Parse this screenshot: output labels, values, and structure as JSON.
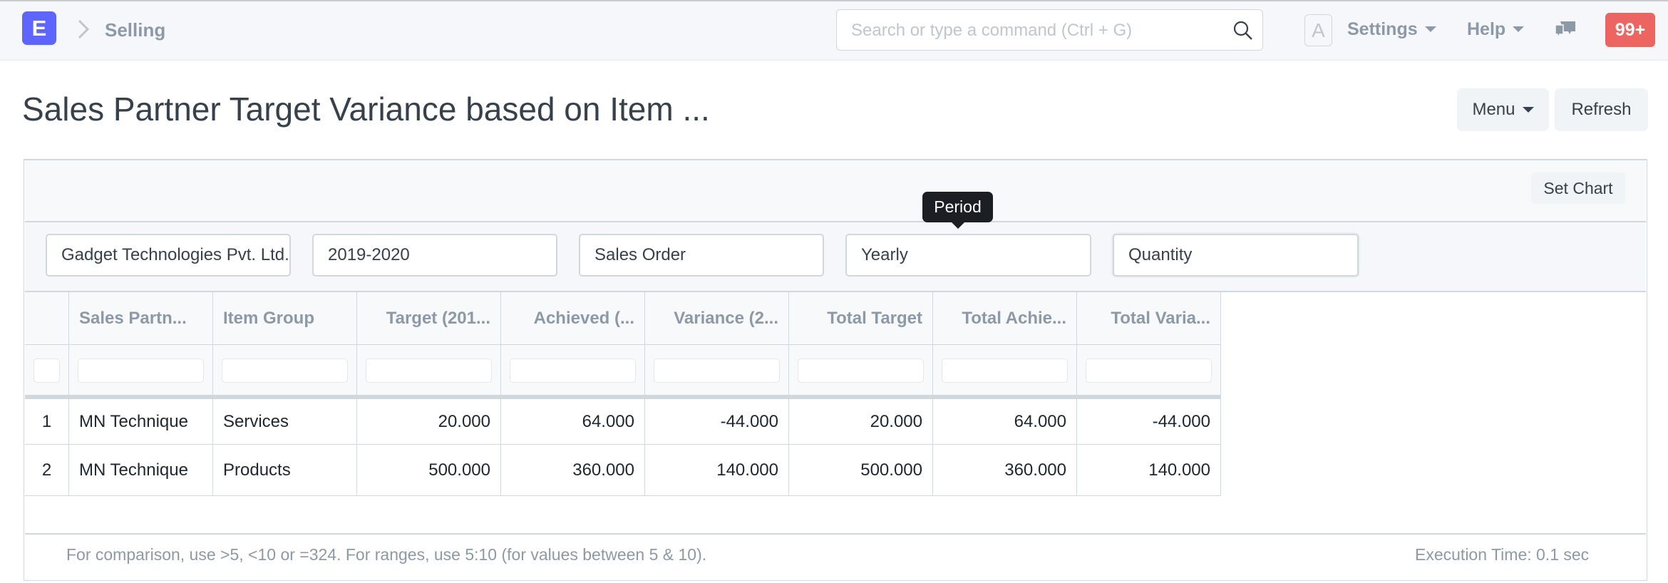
{
  "navbar": {
    "logo_letter": "E",
    "breadcrumb": "Selling",
    "search_placeholder": "Search or type a command (Ctrl + G)",
    "avatar_letter": "A",
    "settings_label": "Settings",
    "help_label": "Help",
    "notifications_badge": "99+",
    "colors": {
      "brand": "#5e64ff",
      "badge": "#ed6561"
    }
  },
  "page": {
    "title": "Sales Partner Target Variance based on Item ...",
    "menu_label": "Menu",
    "refresh_label": "Refresh"
  },
  "report": {
    "set_chart_label": "Set Chart",
    "tooltip": "Period",
    "filters": [
      {
        "name": "company",
        "value": "Gadget Technologies Pvt. Ltd."
      },
      {
        "name": "fiscal-year",
        "value": "2019-2020"
      },
      {
        "name": "doctype",
        "value": "Sales Order"
      },
      {
        "name": "period",
        "value": "Yearly"
      },
      {
        "name": "target-on",
        "value": "Quantity"
      }
    ],
    "columns": [
      "",
      "Sales Partn...",
      "Item Group",
      "Target (201...",
      "Achieved (...",
      "Variance (2...",
      "Total Target",
      "Total Achie...",
      "Total Varia..."
    ],
    "rows": [
      [
        "1",
        "MN Technique",
        "Services",
        "20.000",
        "64.000",
        "-44.000",
        "20.000",
        "64.000",
        "-44.000"
      ],
      [
        "2",
        "MN Technique",
        "Products",
        "500.000",
        "360.000",
        "140.000",
        "500.000",
        "360.000",
        "140.000"
      ]
    ],
    "footer_hint": "For comparison, use >5, <10 or =324. For ranges, use 5:10 (for values between 5 & 10).",
    "execution_time": "Execution Time: 0.1 sec"
  }
}
